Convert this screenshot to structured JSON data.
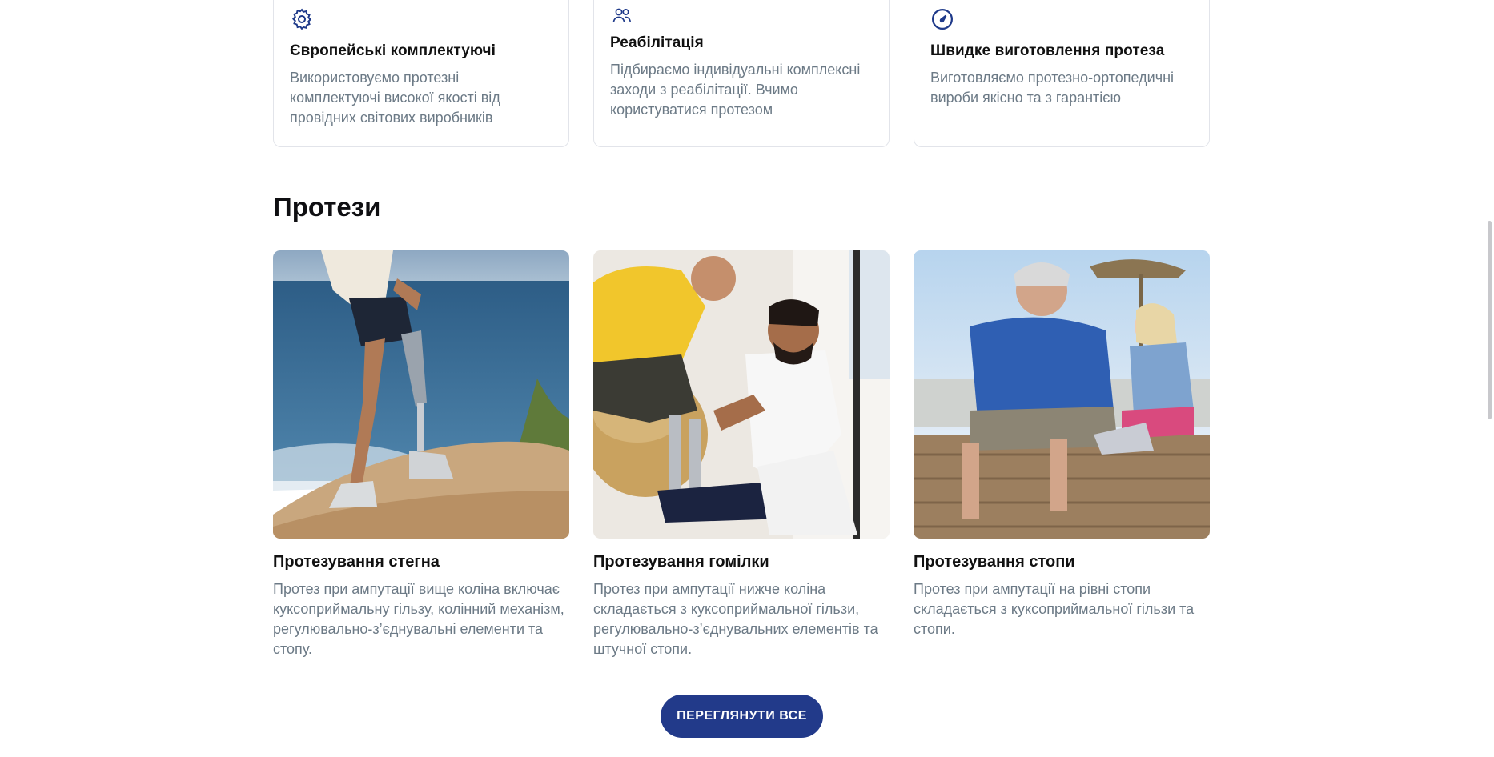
{
  "features": [
    {
      "icon": "gear-icon",
      "title": "Європейські комплектуючі",
      "text": "Використовуємо протезні комплектуючі високої якості від провідних світових виробників"
    },
    {
      "icon": "users-icon",
      "title": "Реабілітація",
      "text": "Підбираємо індивідуальні комплексні заходи з реабілітації. Вчимо користуватися протезом"
    },
    {
      "icon": "speed-icon",
      "title": "Швидке виготовлення протеза",
      "text": "Виготовляємо протезно-ортопедичні вироби якісно та з гарантією"
    }
  ],
  "section": {
    "title": "Протези"
  },
  "products": [
    {
      "title": "Протезування стегна",
      "text": "Протез при ампутації вище коліна включає куксоприймальну гільзу, колінний механізм, регулювально-з’єднувальні елементи та стопу."
    },
    {
      "title": "Протезування гомілки",
      "text": "Протез при ампутації нижче коліна складається з куксоприймальної гільзи, регулювально-з’єднувальних елементів та штучної стопи."
    },
    {
      "title": "Протезування стопи",
      "text": "Протез при ампутації на рівні стопи складається з куксоприймальної гільзи та стопи."
    }
  ],
  "cta": {
    "label": "ПЕРЕГЛЯНУТИ ВСЕ"
  },
  "colors": {
    "accent": "#223a8a",
    "icon": "#1f3a8a",
    "muted_text": "#6c7a86"
  }
}
